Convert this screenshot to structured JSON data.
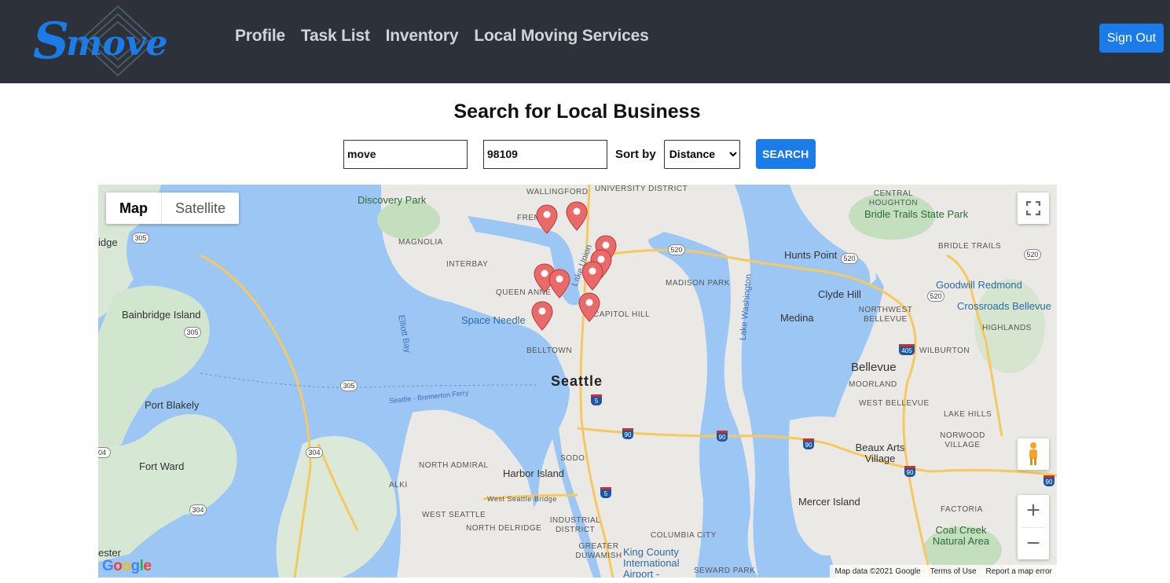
{
  "header": {
    "logo_text": "Smove",
    "nav": [
      "Profile",
      "Task List",
      "Inventory",
      "Local Moving Services"
    ],
    "sign_out": "Sign Out"
  },
  "search": {
    "title": "Search for Local Business",
    "keyword_value": "move",
    "zip_value": "98109",
    "sort_label": "Sort by",
    "sort_selected": "Distance",
    "search_button": "SEARCH"
  },
  "map": {
    "type_tabs": [
      "Map",
      "Satellite"
    ],
    "active_tab": "Map",
    "zoom_in": "+",
    "zoom_out": "−",
    "attribution": [
      "Map data ©2021 Google",
      "Terms of Use",
      "Report a map error"
    ],
    "google_logo": "Google",
    "labels": {
      "seattle": "Seattle",
      "bellevue": "Bellevue",
      "space_needle": "Space Needle",
      "discovery_park": "Discovery Park",
      "bainbridge": "Bainbridge Island",
      "port_blakely": "Port Blakely",
      "fort_ward": "Fort Ward",
      "harbor_island": "Harbor Island",
      "mercer_island": "Mercer Island",
      "medina": "Medina",
      "hunts_point": "Hunts Point",
      "clyde_hill": "Clyde Hill",
      "beaux_arts": "Beaux Arts Village",
      "bridle_trails": "Bridle Trails State Park",
      "coal_creek": "Coal Creek Natural Area",
      "king_county": "King County International Airport -",
      "goodwill": "Goodwill Redmond",
      "crossroads": "Crossroads Bellevue",
      "west_seattle_bridge": "West Seattle Bridge",
      "ferry": "Seattle - Bremerton Ferry",
      "elliott_bay": "Elliott Bay",
      "lake_union": "Lake Union",
      "lake_washington": "Lake Washington",
      "ridge": "idge",
      "ester": "ester",
      "wallingford": "WALLINGFORD",
      "university_district": "UNIVERSITY DISTRICT",
      "fremont": "FREM",
      "magnolia": "MAGNOLIA",
      "interbay": "INTERBAY",
      "queen_anne": "QUEEN ANNE",
      "belltown": "BELLTOWN",
      "capitol_hill": "CAPITOL HILL",
      "madison_park": "MADISON PARK",
      "sodo": "SODO",
      "north_admiral": "NORTH ADMIRAL",
      "alki": "ALKI",
      "west_seattle": "WEST SEATTLE",
      "north_delridge": "NORTH DELRIDGE",
      "industrial_district": "INDUSTRIAL DISTRICT",
      "greater_duwamish": "GREATER DUWAMISH",
      "columbia_city": "COLUMBIA CITY",
      "seward_park": "SEWARD PARK",
      "central_houghton": "CENTRAL HOUGHTON",
      "bridle_trails_nb": "BRIDLE TRAILS",
      "northwest_bellevue": "NORTHWEST BELLEVUE",
      "wilburton": "WILBURTON",
      "moorland": "MOORLAND",
      "west_bellevue": "WEST BELLEVUE",
      "lake_hills": "LAKE HILLS",
      "norwood_village": "NORWOOD VILLAGE",
      "factoria": "FACTORIA",
      "highlands": "HIGHLANDS"
    },
    "shields": [
      "305",
      "305",
      "305",
      "304",
      "304",
      "520",
      "520",
      "520",
      "520",
      "04"
    ],
    "interstates": [
      "5",
      "5",
      "90",
      "90",
      "90",
      "90",
      "405",
      "90"
    ],
    "markers": 10
  }
}
